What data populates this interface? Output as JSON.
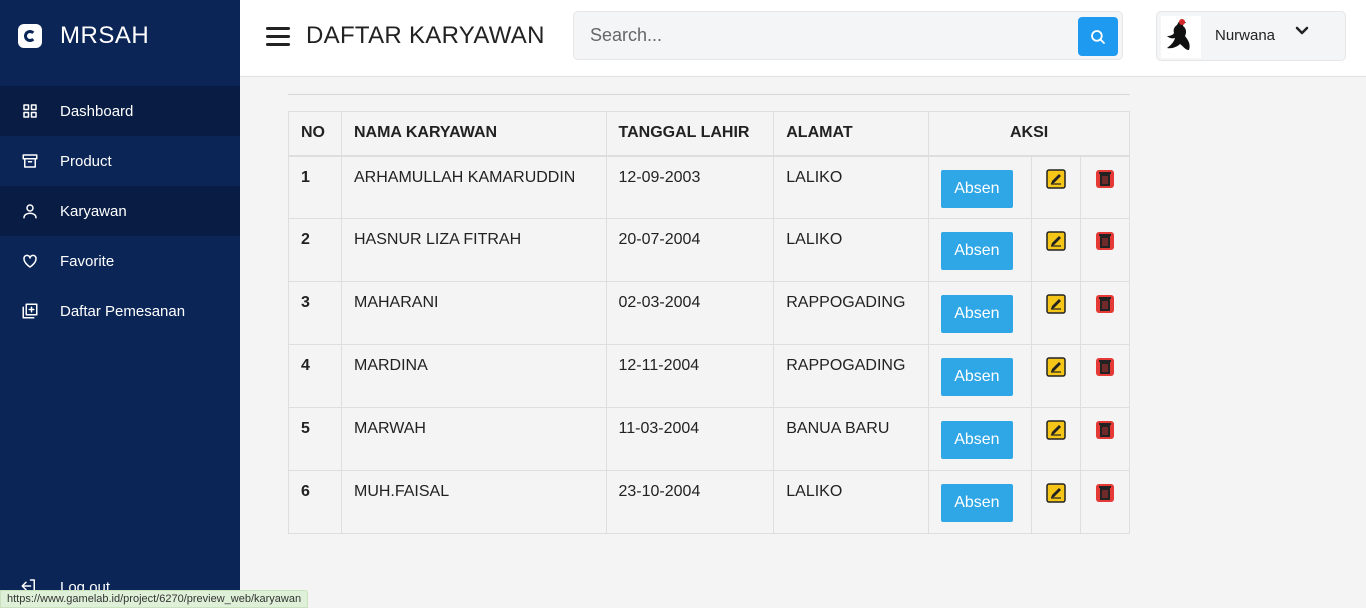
{
  "app": {
    "brand": "MRSAH"
  },
  "sidebar": {
    "items": [
      {
        "label": "Dashboard",
        "icon": "grid-icon"
      },
      {
        "label": "Product",
        "icon": "archive-icon"
      },
      {
        "label": "Karyawan",
        "icon": "user-icon"
      },
      {
        "label": "Favorite",
        "icon": "heart-icon"
      },
      {
        "label": "Daftar Pemesanan",
        "icon": "add-square-icon"
      }
    ],
    "logout": "Log out"
  },
  "header": {
    "title": "DAFTAR KARYAWAN",
    "search_placeholder": "Search...",
    "user_name": "Nurwana"
  },
  "table": {
    "headers": {
      "no": "NO",
      "nama": "NAMA KARYAWAN",
      "tgl": "TANGGAL LAHIR",
      "alamat": "ALAMAT",
      "aksi": "AKSI"
    },
    "absen_label": "Absen",
    "rows": [
      {
        "no": "1",
        "nama": "ARHAMULLAH KAMARUDDIN",
        "tgl": "12-09-2003",
        "alamat": "LALIKO"
      },
      {
        "no": "2",
        "nama": "HASNUR LIZA FITRAH",
        "tgl": "20-07-2004",
        "alamat": "LALIKO"
      },
      {
        "no": "3",
        "nama": "MAHARANI",
        "tgl": "02-03-2004",
        "alamat": "RAPPOGADING"
      },
      {
        "no": "4",
        "nama": "MARDINA",
        "tgl": "12-11-2004",
        "alamat": "RAPPOGADING"
      },
      {
        "no": "5",
        "nama": "MARWAH",
        "tgl": "11-03-2004",
        "alamat": "BANUA BARU"
      },
      {
        "no": "6",
        "nama": "MUH.FAISAL",
        "tgl": "23-10-2004",
        "alamat": "LALIKO"
      }
    ]
  },
  "status_url": "https://www.gamelab.id/project/6270/preview_web/karyawan",
  "colors": {
    "sidebar": "#0b2557",
    "accent": "#1e9bf0",
    "absen": "#2fa6e6",
    "edit": "#f5c518",
    "delete": "#e53935"
  }
}
